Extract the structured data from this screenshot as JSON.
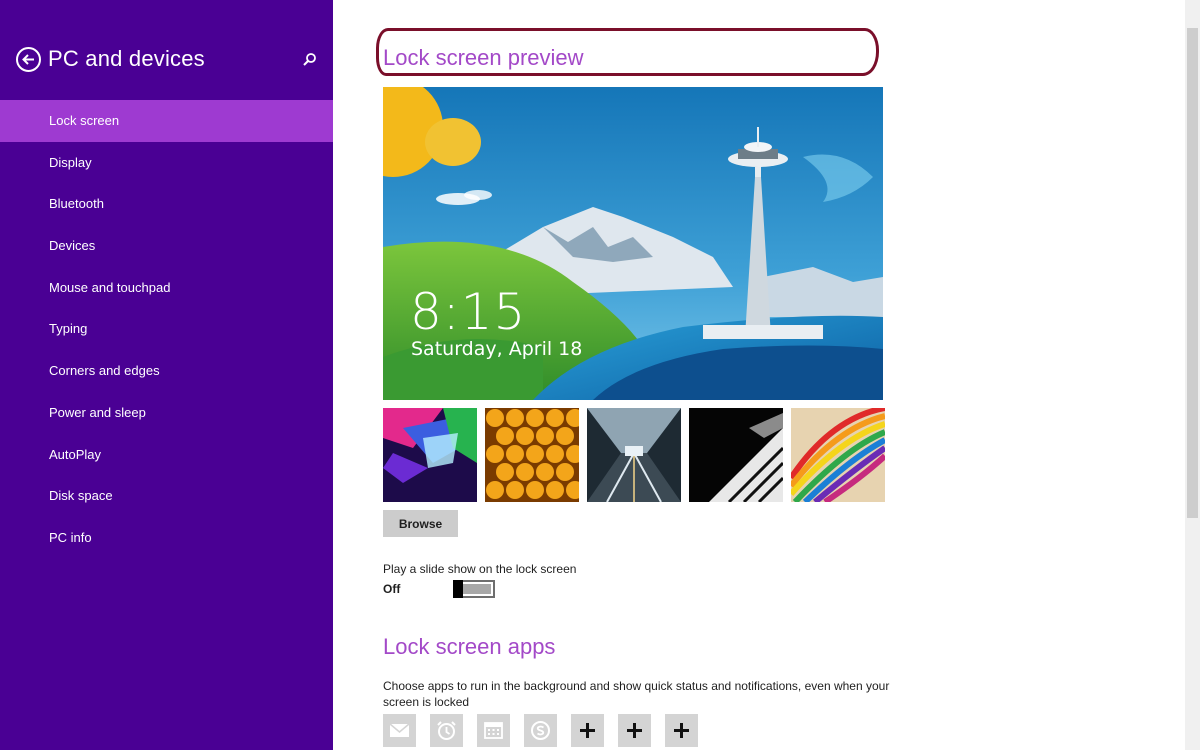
{
  "colors": {
    "sidebar_bg": "#4a0094",
    "sidebar_active": "#9e3ad1",
    "accent_title": "#a349c8",
    "annotation_outline": "#7a0f2a"
  },
  "sidebar": {
    "back_icon": "back-arrow-icon",
    "title": "PC and devices",
    "search_icon": "search-icon",
    "items": [
      {
        "label": "Lock screen",
        "active": true
      },
      {
        "label": "Display"
      },
      {
        "label": "Bluetooth"
      },
      {
        "label": "Devices"
      },
      {
        "label": "Mouse and touchpad"
      },
      {
        "label": "Typing"
      },
      {
        "label": "Corners and edges"
      },
      {
        "label": "Power and sleep"
      },
      {
        "label": "AutoPlay"
      },
      {
        "label": "Disk space"
      },
      {
        "label": "PC info"
      }
    ]
  },
  "main": {
    "preview_title": "Lock screen preview",
    "preview": {
      "time": "8:15",
      "date": "Saturday, April 18"
    },
    "thumbnails": [
      "abstract-color-panels",
      "honeycomb",
      "light-tunnel",
      "piano-keys",
      "rainbow-stripes"
    ],
    "browse_label": "Browse",
    "slideshow": {
      "label": "Play a slide show on the lock screen",
      "state": "Off"
    },
    "apps_title": "Lock screen apps",
    "apps_description": "Choose apps to run in the background and show quick status and notifications, even when your screen is locked",
    "app_slots": [
      "mail-icon",
      "alarm-icon",
      "calendar-icon",
      "skype-icon",
      "plus-icon",
      "plus-icon",
      "plus-icon"
    ]
  }
}
